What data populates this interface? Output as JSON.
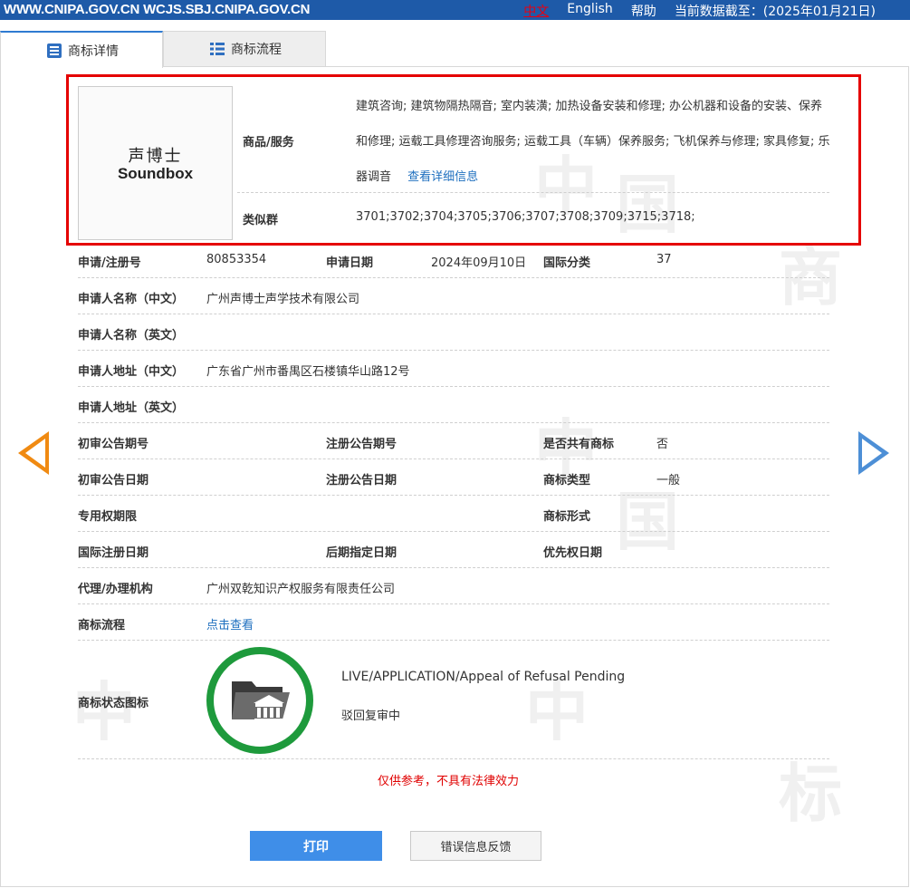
{
  "topbar": {
    "site": "WWW.CNIPA.GOV.CN WCJS.SBJ.CNIPA.GOV.CN",
    "lang_cn": "中文",
    "lang_en": "English",
    "help": "帮助",
    "data_date": "当前数据截至：(2025年01月21日)"
  },
  "tabs": {
    "detail": "商标详情",
    "flow": "商标流程"
  },
  "logo": {
    "cn": "声博士",
    "en": "Soundbox"
  },
  "goods": {
    "label": "商品/服务",
    "text": "建筑咨询; 建筑物隔热隔音; 室内装潢; 加热设备安装和修理; 办公机器和设备的安装、保养和修理; 运载工具修理咨询服务; 运载工具（车辆）保养服务; 飞机保养与修理; 家具修复; 乐器调音",
    "link": "查看详细信息"
  },
  "similar": {
    "label": "类似群",
    "value": "3701;3702;3704;3705;3706;3707;3708;3709;3715;3718;"
  },
  "fields": {
    "reg_no_label": "申请/注册号",
    "reg_no": "80853354",
    "apply_date_label": "申请日期",
    "apply_date": "2024年09月10日",
    "intl_class_label": "国际分类",
    "intl_class": "37",
    "applicant_cn_label": "申请人名称（中文）",
    "applicant_cn": "广州声博士声学技术有限公司",
    "applicant_en_label": "申请人名称（英文）",
    "address_cn_label": "申请人地址（中文）",
    "address_cn": "广东省广州市番禺区石楼镇华山路12号",
    "address_en_label": "申请人地址（英文）",
    "prelim_pub_no_label": "初审公告期号",
    "reg_pub_no_label": "注册公告期号",
    "shared_label": "是否共有商标",
    "shared": "否",
    "prelim_pub_date_label": "初审公告日期",
    "reg_pub_date_label": "注册公告日期",
    "mark_type_label": "商标类型",
    "mark_type": "一般",
    "exclusive_term_label": "专用权期限",
    "mark_form_label": "商标形式",
    "intl_reg_date_label": "国际注册日期",
    "later_designation_label": "后期指定日期",
    "priority_date_label": "优先权日期",
    "agent_label": "代理/办理机构",
    "agent": "广州双乾知识产权服务有限责任公司",
    "flow_label": "商标流程",
    "flow_link": "点击查看",
    "status_icon_label": "商标状态图标",
    "status_en": "LIVE/APPLICATION/Appeal of Refusal Pending",
    "status_cn": "驳回复审中"
  },
  "disclaimer": "仅供参考，不具有法律效力",
  "buttons": {
    "print": "打印",
    "feedback": "错误信息反馈"
  },
  "colors": {
    "topbar": "#1e5aa8",
    "highlight_box": "#e50000",
    "link": "#1e6fbf",
    "status_ring": "#1e9a3c",
    "prev_arrow": "#f08a12",
    "next_arrow": "#4d8fd6",
    "print_button": "#3f8ee8"
  }
}
